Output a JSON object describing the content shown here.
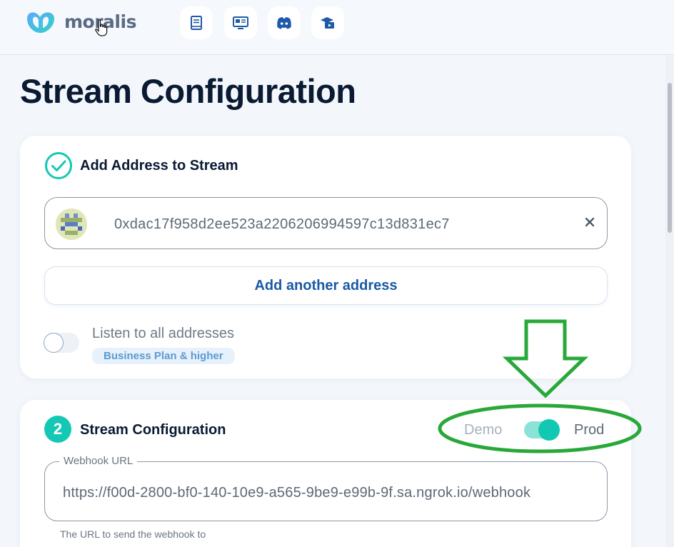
{
  "header": {
    "brand": "moralis",
    "nav_icons": [
      "docs-book-icon",
      "monitor-icon",
      "discord-icon",
      "academy-video-icon"
    ]
  },
  "page": {
    "title": "Stream Configuration"
  },
  "step1": {
    "title": "Add Address to Stream",
    "address": "0xdac17f958d2ee523a2206206994597c13d831ec7",
    "add_another_label": "Add another address",
    "listen_all_label": "Listen to all addresses",
    "listen_all_enabled": false,
    "plan_badge": "Business Plan & higher"
  },
  "step2": {
    "number": "2",
    "title": "Stream Configuration",
    "env_demo_label": "Demo",
    "env_prod_label": "Prod",
    "env_selected": "Prod",
    "webhook_label": "Webhook URL",
    "webhook_value": "https://f00d-2800-bf0-140-10e9-a565-9be9-e99b-9f.sa.ngrok.io/webhook",
    "webhook_helper": "The URL to send the webhook to"
  },
  "colors": {
    "accent_teal": "#14c8b3",
    "link_blue": "#1a5aa6",
    "annotation_green": "#29a83a"
  }
}
